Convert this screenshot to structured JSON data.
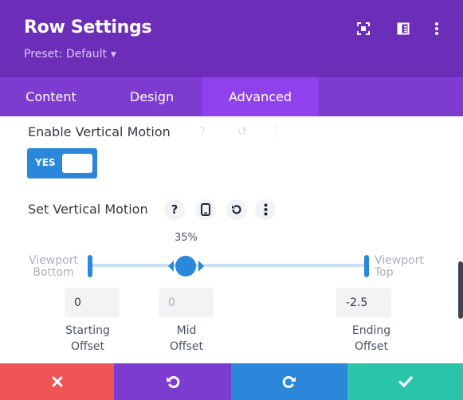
{
  "header": {
    "title": "Row Settings",
    "preset_label": "Preset: Default",
    "icons": [
      "focus-icon",
      "split-view-icon",
      "more-icon"
    ],
    "background": "#6c2eb9"
  },
  "tabs": [
    {
      "label": "Content",
      "active": false
    },
    {
      "label": "Design",
      "active": false
    },
    {
      "label": "Advanced",
      "active": true
    }
  ],
  "vertical_motion": {
    "enable_label": "Enable Vertical Motion",
    "toggle_label": "YES",
    "toggle_on": true,
    "set_label": "Set Vertical Motion",
    "mid_percent_label": "35%",
    "mid_percent": 35,
    "viewport_bottom": [
      "Viewport",
      "Bottom"
    ],
    "viewport_top": [
      "Viewport",
      "Top"
    ],
    "inputs": {
      "starting": {
        "value": "0",
        "caption": [
          "Starting",
          "Offset"
        ]
      },
      "mid": {
        "value": "0",
        "caption": [
          "Mid",
          "Offset"
        ]
      },
      "ending": {
        "value": "-2.5",
        "caption": [
          "Ending",
          "Offset"
        ]
      }
    }
  },
  "footer": {
    "buttons": [
      {
        "name": "discard",
        "icon": "close-icon",
        "color": "#ef5555"
      },
      {
        "name": "undo",
        "icon": "undo-icon",
        "color": "#7e3bd0"
      },
      {
        "name": "redo",
        "icon": "redo-icon",
        "color": "#2b87da"
      },
      {
        "name": "save",
        "icon": "check-icon",
        "color": "#29c4a9"
      }
    ]
  },
  "colors": {
    "accent": "#2b87da",
    "tab_bar": "#7e3bd0",
    "tab_active": "#8f42ec"
  }
}
